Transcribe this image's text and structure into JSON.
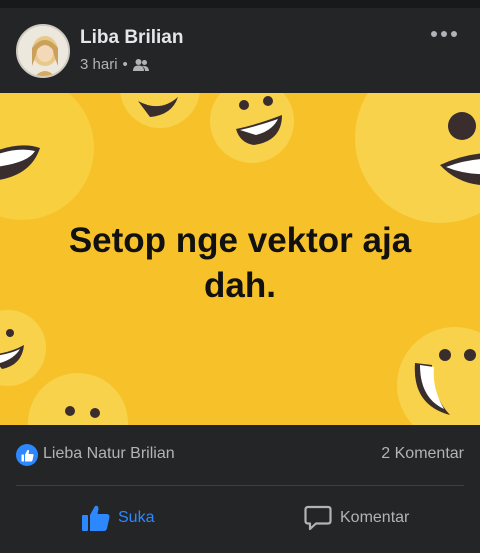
{
  "post": {
    "author": "Liba Brilian",
    "time": "3 hari",
    "separator": "•",
    "audience_icon": "friends-icon",
    "more_icon": "more-options-icon",
    "image_text": "Setop nge vektor aja dah.",
    "image_background": "#f7c12a"
  },
  "reactions": {
    "reactor_name": "Lieba Natur Brilian",
    "comment_count": "2 Komentar",
    "icon": "like-badge-icon"
  },
  "actions": {
    "like_label": "Suka",
    "comment_label": "Komentar",
    "active_color": "#2d88ff"
  }
}
